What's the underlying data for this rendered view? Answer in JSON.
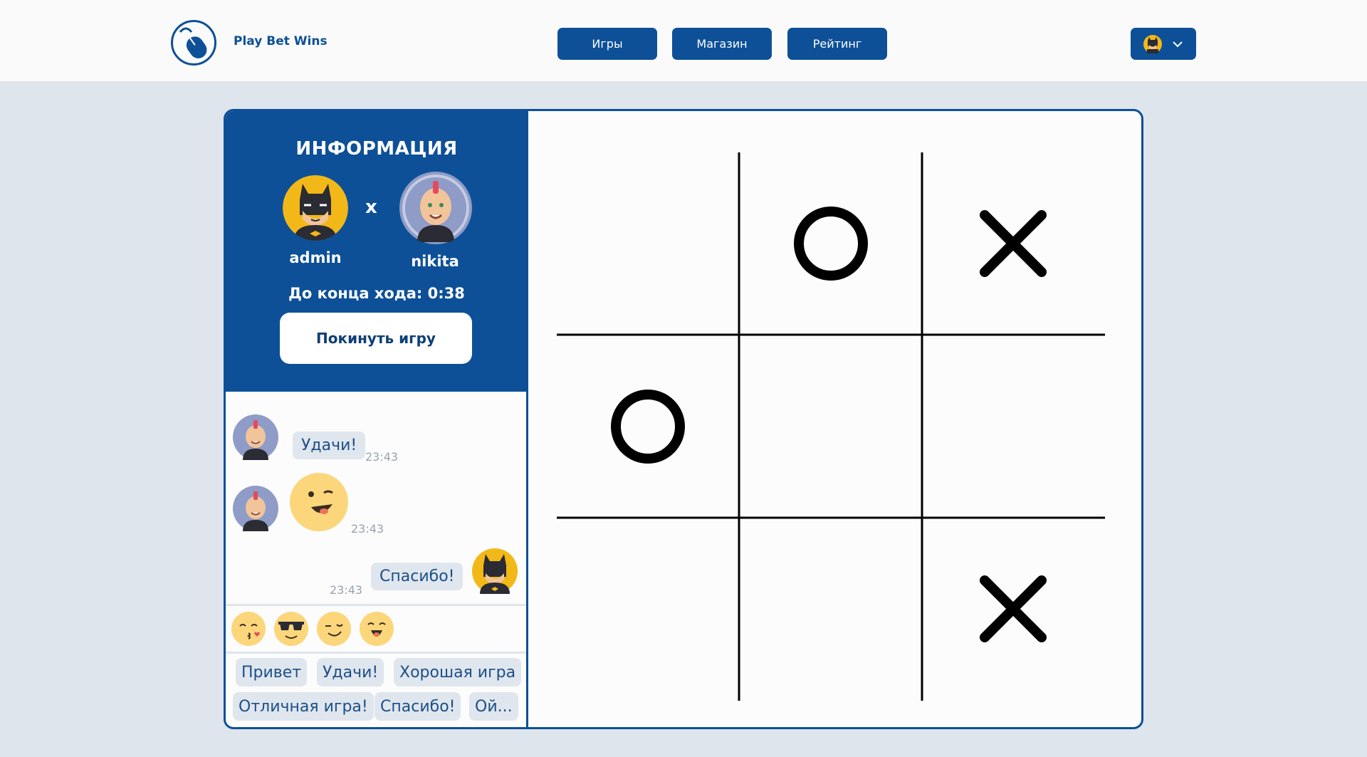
{
  "header": {
    "logo_text": "Play Bet Wins",
    "nav": [
      "Игры",
      "Магазин",
      "Рейтинг"
    ],
    "user_menu_icon": "chevron-down-icon"
  },
  "info": {
    "title": "ИНФОРМАЦИЯ",
    "player1": "admin",
    "versus": "x",
    "player2": "nikita",
    "timer": "До конца хода: 0:38",
    "leave_button": "Покинуть игру"
  },
  "chat": {
    "messages": [
      {
        "from": "nikita",
        "text": "Удачи!",
        "time": "23:43"
      },
      {
        "from": "nikita",
        "emoji": "winking-emoji",
        "time": "23:43"
      },
      {
        "from": "admin",
        "text": "Спасибо!",
        "time": "23:43"
      }
    ],
    "emojis": [
      "kiss-emoji",
      "sunglasses-emoji",
      "wink-emoji",
      "laugh-emoji"
    ],
    "quick_replies": [
      "Привет",
      "Удачи!",
      "Хорошая игра",
      "Отличная игра!",
      "Спасибо!",
      "Ой..."
    ]
  },
  "board": {
    "cells": [
      "",
      "O",
      "X",
      "O",
      "",
      "",
      "",
      "",
      "X"
    ]
  },
  "colors": {
    "primary": "#0d5097",
    "background": "#dee5ed",
    "bubble": "#dfe6ee",
    "emoji": "#fcd67b"
  }
}
